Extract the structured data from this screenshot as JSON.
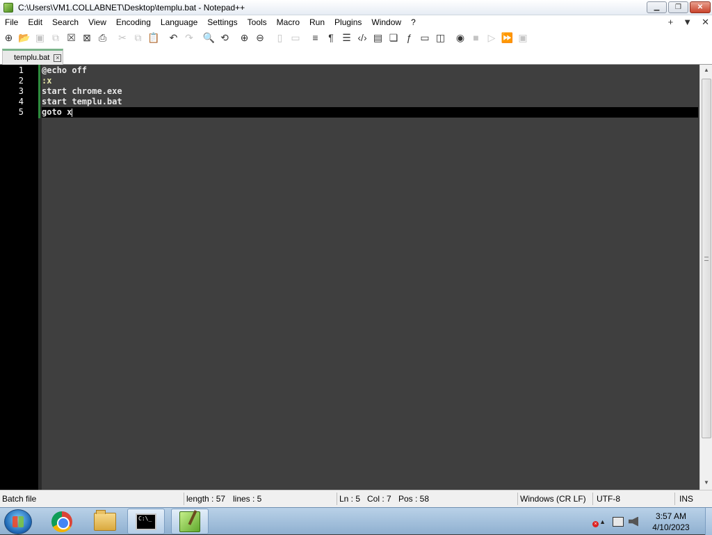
{
  "window": {
    "title": "C:\\Users\\VM1.COLLABNET\\Desktop\\templu.bat - Notepad++",
    "controls": [
      "minimize",
      "maximize",
      "close"
    ]
  },
  "menu": {
    "items": [
      "File",
      "Edit",
      "Search",
      "View",
      "Encoding",
      "Language",
      "Settings",
      "Tools",
      "Macro",
      "Run",
      "Plugins",
      "Window",
      "?"
    ],
    "right": [
      "+",
      "▼",
      "✕"
    ]
  },
  "toolbar": {
    "icons": [
      "new-file-icon",
      "open-file-icon",
      "save-icon",
      "save-all-icon",
      "close-icon",
      "close-all-icon",
      "print-icon",
      "cut-icon",
      "copy-icon",
      "paste-icon",
      "undo-icon",
      "redo-icon",
      "find-icon",
      "replace-icon",
      "zoom-in-icon",
      "zoom-out-icon",
      "sync-vertical-icon",
      "sync-horizontal-icon",
      "word-wrap-icon",
      "show-all-characters-icon",
      "indent-guide-icon",
      "xml-tag-icon",
      "document-map-icon",
      "function-list-icon",
      "fx-icon",
      "monitoring-icon",
      "screenshot-icon",
      "record-macro-icon",
      "stop-macro-icon",
      "play-macro-icon",
      "run-macro-multiple-icon",
      "save-macro-icon"
    ]
  },
  "tabs": [
    {
      "label": "templu.bat",
      "active": true
    }
  ],
  "editor": {
    "lines": [
      {
        "number": "1",
        "text": "@echo off"
      },
      {
        "number": "2",
        "text": ":x"
      },
      {
        "number": "3",
        "text": "start chrome.exe"
      },
      {
        "number": "4",
        "text": "start templu.bat"
      },
      {
        "number": "5",
        "text": "goto x"
      }
    ],
    "current_line": 5
  },
  "status": {
    "file_type": "Batch file",
    "length": "length : 57",
    "lines": "lines : 5",
    "ln": "Ln : 5",
    "col": "Col : 7",
    "pos": "Pos : 58",
    "eol": "Windows (CR LF)",
    "encoding": "UTF-8",
    "mode": "INS"
  },
  "taskbar": {
    "apps": [
      "start-button",
      "chrome",
      "file-explorer",
      "command-prompt",
      "notepad-plus-plus"
    ],
    "clock_time": "3:57 AM",
    "clock_date": "4/10/2023"
  }
}
